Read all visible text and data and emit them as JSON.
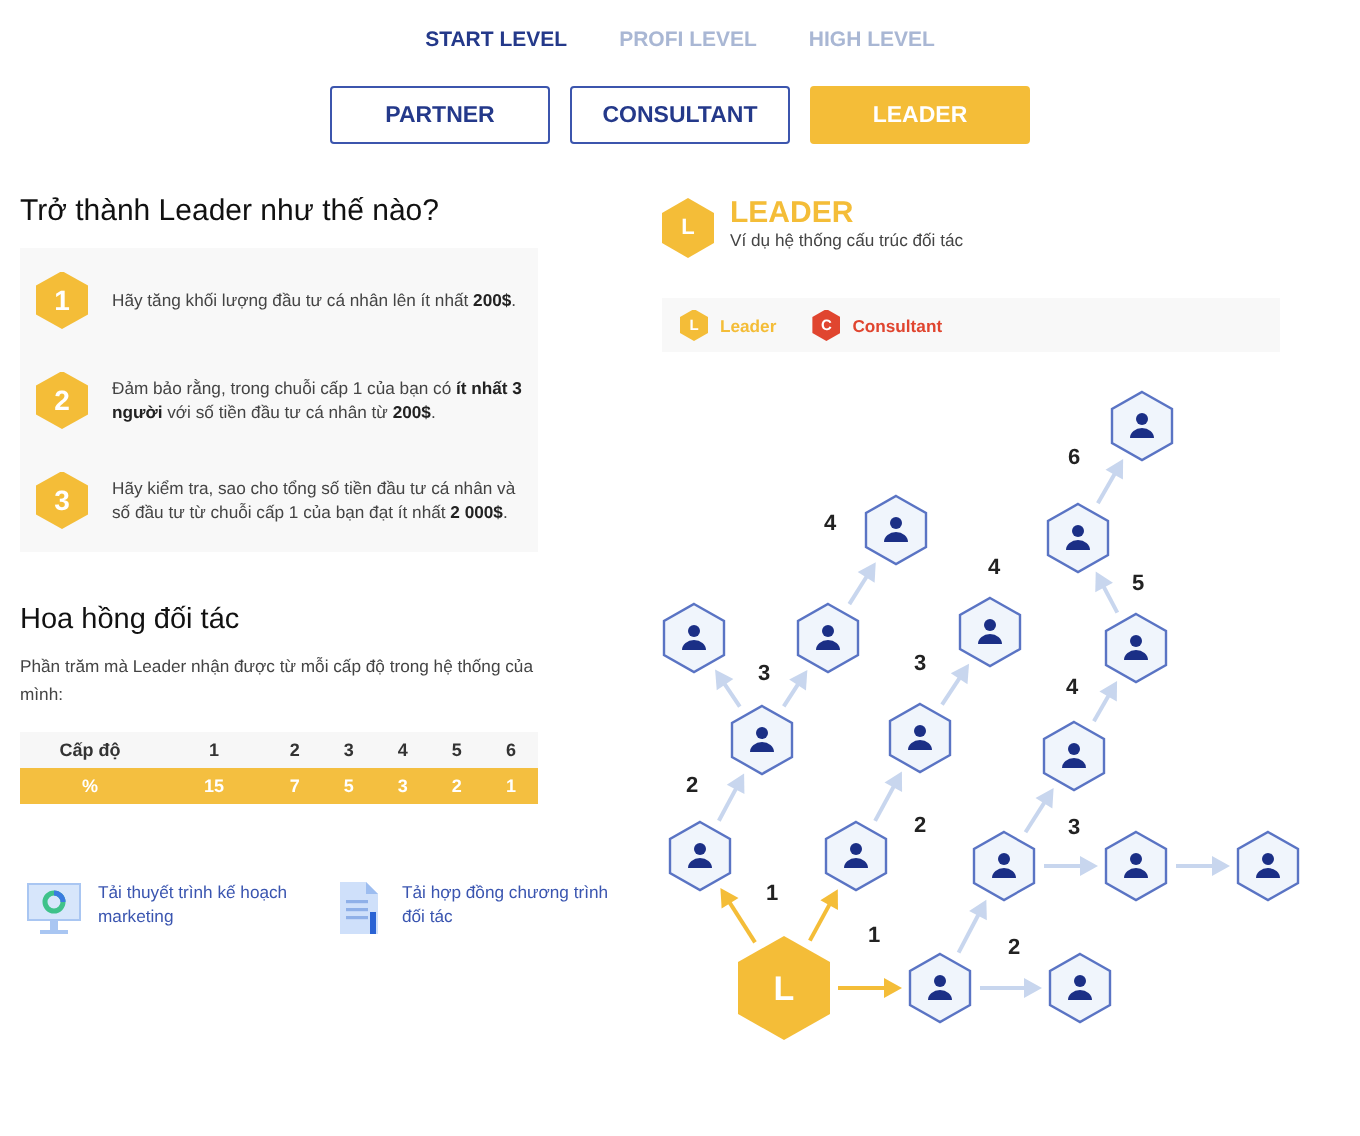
{
  "level_tabs": [
    {
      "label": "START LEVEL",
      "selected": true
    },
    {
      "label": "PROFI LEVEL",
      "selected": false
    },
    {
      "label": "HIGH LEVEL",
      "selected": false
    }
  ],
  "role_buttons": [
    {
      "label": "PARTNER",
      "selected": false
    },
    {
      "label": "CONSULTANT",
      "selected": false
    },
    {
      "label": "LEADER",
      "selected": true
    }
  ],
  "requirements": {
    "title": "Trở thành Leader như thế nào?",
    "steps": [
      {
        "number": "1",
        "text": "Hãy tăng khối lượng đầu tư cá nhân lên ít nhất **200$**."
      },
      {
        "number": "2",
        "text": "Đảm bảo rằng, trong chuỗi cấp 1 của bạn có **ít nhất 3 người** với số tiền đầu tư cá nhân từ **200$**."
      },
      {
        "number": "3",
        "text": "Hãy kiểm tra, sao cho tổng số tiền đầu tư cá nhân và số đầu tư từ chuỗi cấp 1 của bạn đạt ít nhất **2 000$**."
      }
    ]
  },
  "commission": {
    "title": "Hoa hồng đối tác",
    "description": "Phần trăm mà Leader nhận được từ mỗi cấp độ trong hệ thống của mình:",
    "table": {
      "columns": [
        "Cấp độ",
        "1",
        "2",
        "3",
        "4",
        "5",
        "6"
      ],
      "rows": [
        [
          "%",
          "15",
          "7",
          "5",
          "3",
          "2",
          "1"
        ]
      ]
    }
  },
  "downloads": [
    {
      "kind": "presentation",
      "label": "Tải thuyết trình kế hoạch marketing"
    },
    {
      "kind": "document",
      "label": "Tải hợp đồng chương trình đối tác"
    }
  ],
  "structure": {
    "badge": "L",
    "title": "LEADER",
    "subtitle": "Ví dụ hệ thống cấu trúc đối tác",
    "legend": [
      {
        "badge": "L",
        "label": "Leader",
        "color": "#f4bd38"
      },
      {
        "badge": "C",
        "label": "Consultant",
        "color": "#e0452f"
      }
    ],
    "root_badge": "L",
    "level_labels": [
      "1",
      "1",
      "2",
      "2",
      "2",
      "3",
      "3",
      "3",
      "4",
      "4",
      "4",
      "5",
      "6"
    ]
  }
}
